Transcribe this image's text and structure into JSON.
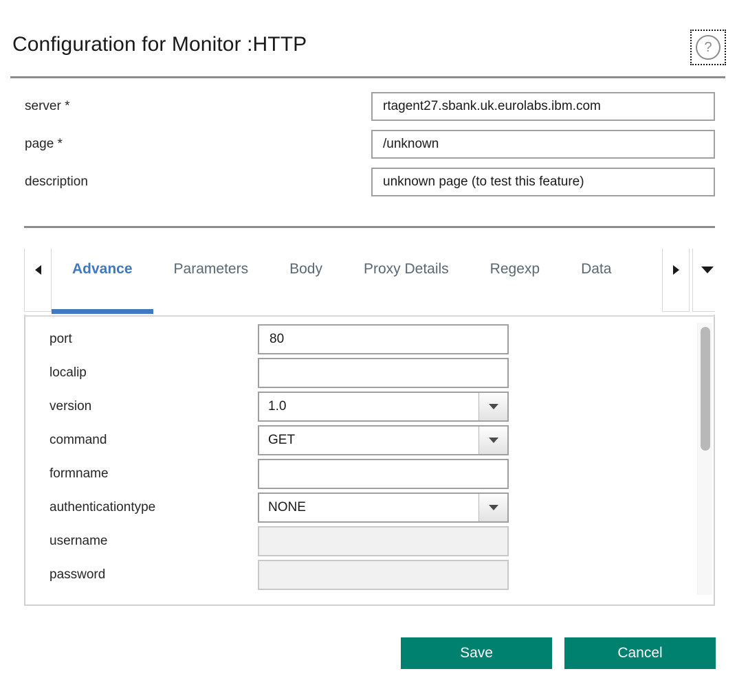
{
  "header": {
    "title": "Configuration for Monitor :HTTP",
    "help_icon_glyph": "?",
    "help_icon_name": "question-mark-icon"
  },
  "top_form": {
    "fields": [
      {
        "label": "server *",
        "value": "rtagent27.sbank.uk.eurolabs.ibm.com",
        "placeholder": "",
        "name": "server"
      },
      {
        "label": "page *",
        "value": "/unknown",
        "placeholder": "",
        "name": "page"
      },
      {
        "label": "description",
        "value": "unknown page (to test this feature)",
        "placeholder": "",
        "name": "description"
      }
    ]
  },
  "tabs": {
    "scroll_left_icon": "triangle-left-icon",
    "scroll_right_icon": "triangle-right-icon",
    "overflow_icon": "chevron-down-icon",
    "active_index": 0,
    "accent_color": "#4178be",
    "items": [
      {
        "label": "Advance"
      },
      {
        "label": "Parameters"
      },
      {
        "label": "Body"
      },
      {
        "label": "Proxy Details"
      },
      {
        "label": "Regexp"
      },
      {
        "label": "Data"
      }
    ]
  },
  "panel": {
    "fields": [
      {
        "label": "port",
        "type": "text",
        "value": "80",
        "disabled": false
      },
      {
        "label": "localip",
        "type": "text",
        "value": "",
        "disabled": false
      },
      {
        "label": "version",
        "type": "select",
        "value": "1.0",
        "disabled": false
      },
      {
        "label": "command",
        "type": "select",
        "value": "GET",
        "disabled": false
      },
      {
        "label": "formname",
        "type": "text",
        "value": "",
        "disabled": false
      },
      {
        "label": "authenticationtype",
        "type": "select",
        "value": "NONE",
        "disabled": false
      },
      {
        "label": "username",
        "type": "text",
        "value": "",
        "disabled": true
      },
      {
        "label": "password",
        "type": "text",
        "value": "",
        "disabled": true
      }
    ],
    "scrollbar": {
      "name": "vertical-scrollbar"
    }
  },
  "footer": {
    "save_label": "Save",
    "cancel_label": "Cancel",
    "button_color": "#00806f"
  }
}
